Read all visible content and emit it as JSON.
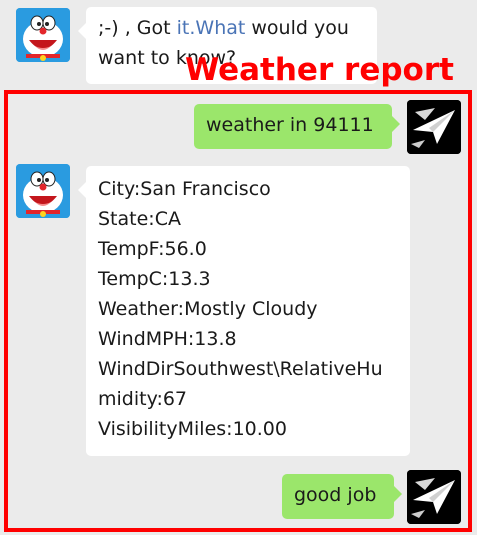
{
  "annotation": {
    "label": "Weather report",
    "color": "#ff0000"
  },
  "messages": {
    "m1": {
      "sender": "bot",
      "prefix": ";-) , Got ",
      "link": "it.What",
      "suffix": " would you",
      "line2": "want to know?"
    },
    "m2": {
      "sender": "user",
      "text": "weather in 94111"
    },
    "m3": {
      "sender": "bot",
      "lines": [
        "City:San Francisco",
        "State:CA",
        "TempF:56.0",
        "TempC:13.3",
        "Weather:Mostly Cloudy",
        "WindMPH:13.8",
        "WindDirSouthwest\\RelativeHu",
        "midity:67",
        "VisibilityMiles:10.00"
      ]
    },
    "m4": {
      "sender": "user",
      "text": "good job"
    }
  },
  "avatars": {
    "bot": "doraemon-avatar",
    "user": "paper-plane-avatar"
  },
  "colors": {
    "background": "#ebebeb",
    "user_bubble": "#9be66b",
    "bot_bubble": "#ffffff",
    "link": "#4a74b6"
  }
}
